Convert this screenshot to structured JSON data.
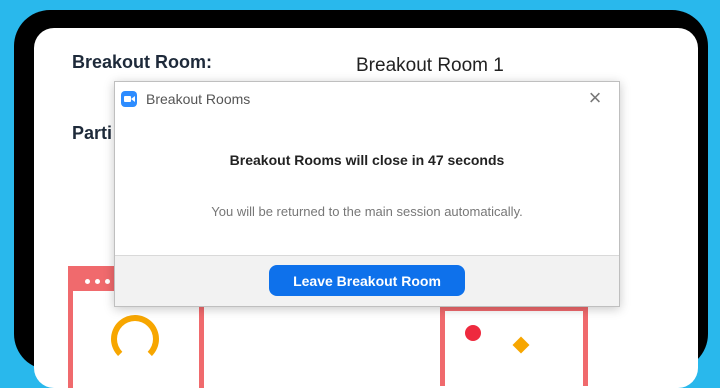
{
  "background": {
    "breakout_room_label": "Breakout Room:",
    "breakout_room_value": "Breakout Room 1",
    "participants_label_partial": "Parti"
  },
  "dialog": {
    "title": "Breakout Rooms",
    "app_icon": "video-camera-icon",
    "close_icon": "close-icon",
    "headline": "Breakout Rooms will close in 47 seconds",
    "subtext": "You will be returned to the main session automatically.",
    "leave_button_label": "Leave Breakout Room"
  },
  "colors": {
    "page_background": "#29b8ec",
    "accent_blue": "#0e71eb",
    "illustration_red": "#f06a6d",
    "illustration_yellow": "#f7a600"
  }
}
